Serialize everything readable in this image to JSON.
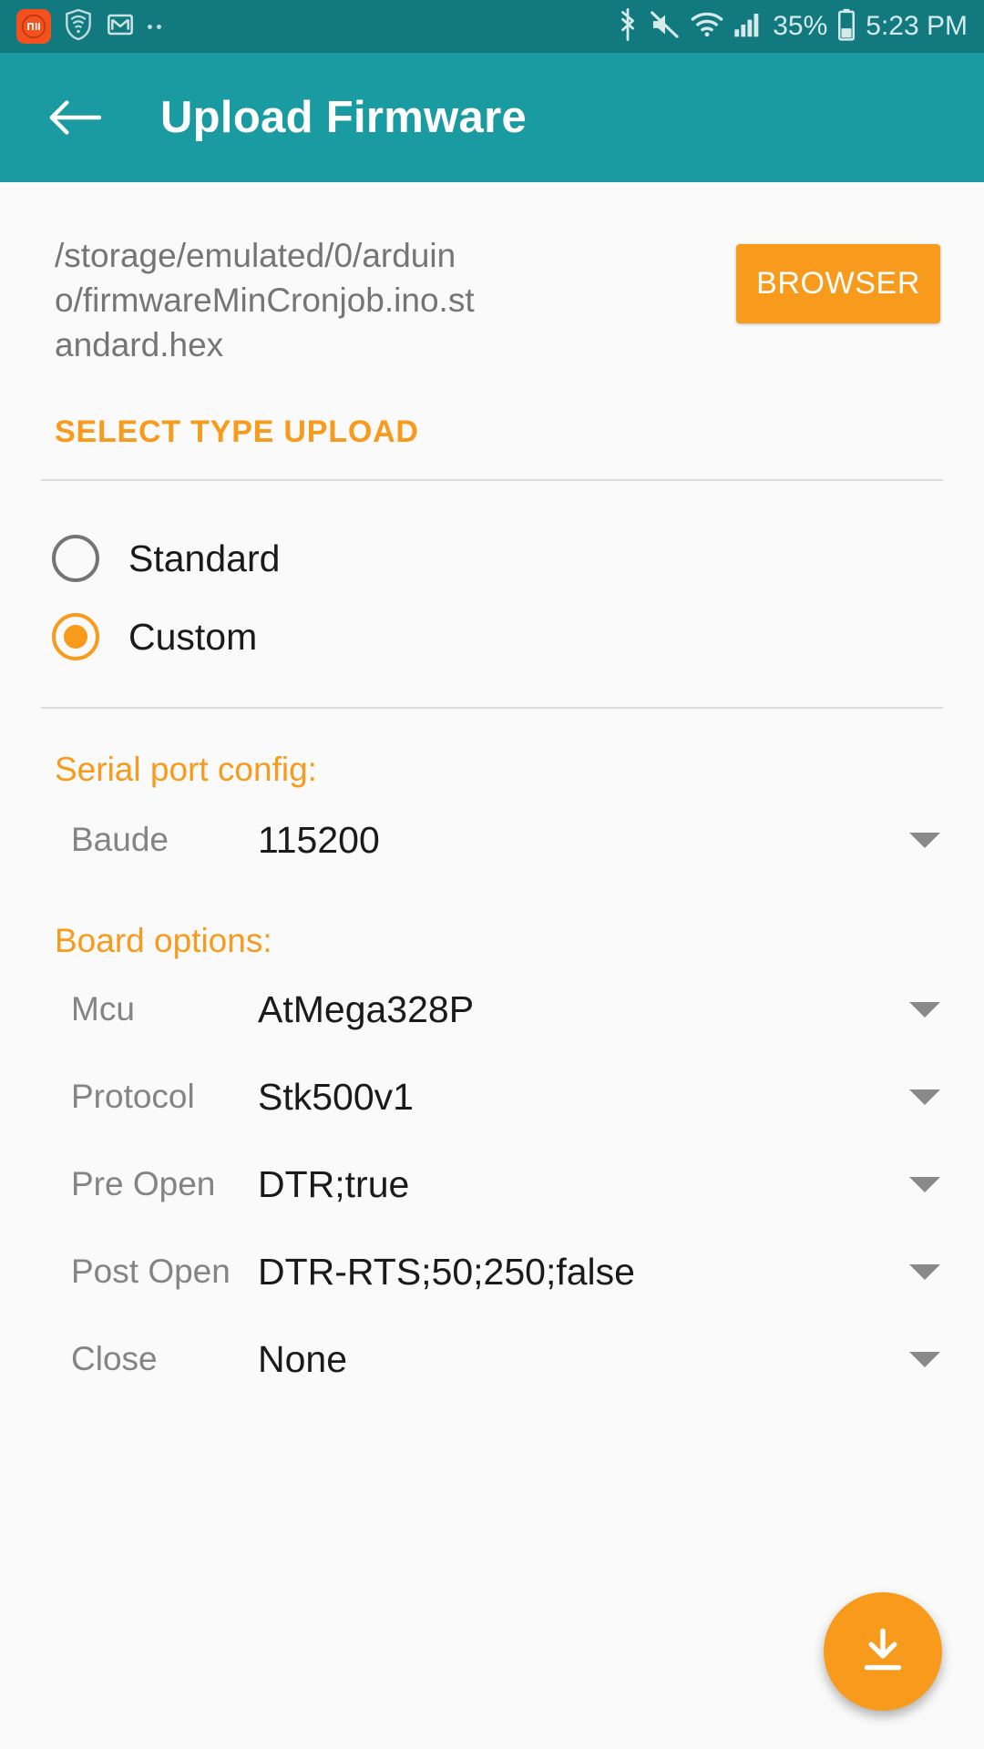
{
  "status_bar": {
    "background": "#12797F",
    "left_icons": [
      {
        "name": "mi-app-icon",
        "glyph": "mi",
        "color": "#F4511E"
      },
      {
        "name": "security-shield-icon",
        "glyph": "shield-wifi"
      },
      {
        "name": "gmail-icon",
        "glyph": "M"
      },
      {
        "name": "more-notifications-icon",
        "glyph": "dots"
      }
    ],
    "right_icons": [
      {
        "name": "bluetooth-icon"
      },
      {
        "name": "volume-mute-icon"
      },
      {
        "name": "wifi-icon"
      },
      {
        "name": "cellular-signal-icon"
      }
    ],
    "battery_percent": "35%",
    "clock": "5:23 PM"
  },
  "toolbar": {
    "background": "#1A9BA1",
    "back_label": "back-arrow",
    "title": "Upload Firmware"
  },
  "file": {
    "path": "/storage/emulated/0/arduino/firmwareMinCronjob.ino.standard.hex",
    "browser_button": "BROWSER",
    "accent": "#F89A1C"
  },
  "upload_type": {
    "section_title": "SELECT TYPE UPLOAD",
    "options": [
      {
        "label": "Standard",
        "selected": false
      },
      {
        "label": "Custom",
        "selected": true
      }
    ]
  },
  "serial_port_config": {
    "title": "Serial port config:",
    "rows": [
      {
        "label": "Baude",
        "value": "115200"
      }
    ]
  },
  "board_options": {
    "title": "Board options:",
    "rows": [
      {
        "label": "Mcu",
        "value": "AtMega328P"
      },
      {
        "label": "Protocol",
        "value": "Stk500v1"
      },
      {
        "label": "Pre Open",
        "value": "DTR;true"
      },
      {
        "label": "Post Open",
        "value": "DTR-RTS;50;250;false"
      },
      {
        "label": "Close",
        "value": "None"
      }
    ]
  },
  "fab": {
    "name": "upload-download-fab",
    "color": "#F89A1C"
  }
}
